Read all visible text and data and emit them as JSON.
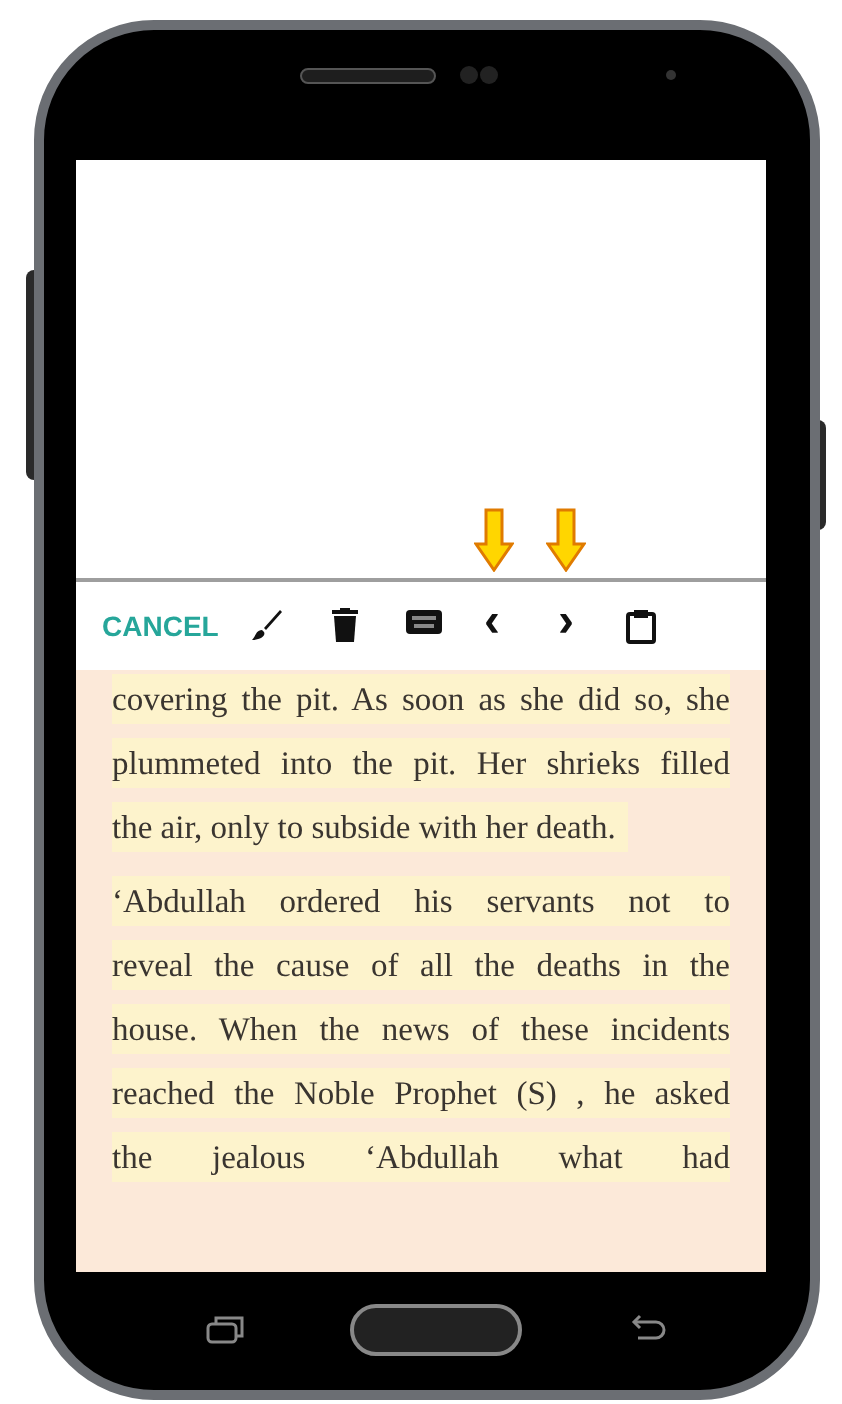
{
  "toolbar": {
    "cancel": "CANCEL",
    "prev": "‹",
    "next": "›"
  },
  "paragraphs": [
    {
      "lines": [
        {
          "text": "covering the pit. As soon as she did so, she",
          "justified": true
        },
        {
          "text": "plummeted into the pit. Her shrieks filled",
          "justified": true
        },
        {
          "text": "the air, only to subside with her death.",
          "justified": false
        }
      ]
    },
    {
      "lines": [
        {
          "text": "‘Abdullah ordered his servants not to",
          "justified": true
        },
        {
          "text": "reveal the cause of all the deaths in the",
          "justified": true
        },
        {
          "text": "house. When the news of these incidents",
          "justified": true
        },
        {
          "text": "reached the Noble Prophet (S) , he asked",
          "justified": true
        },
        {
          "text": "the jealous ‘Abdullah what had",
          "justified": true
        }
      ]
    }
  ]
}
